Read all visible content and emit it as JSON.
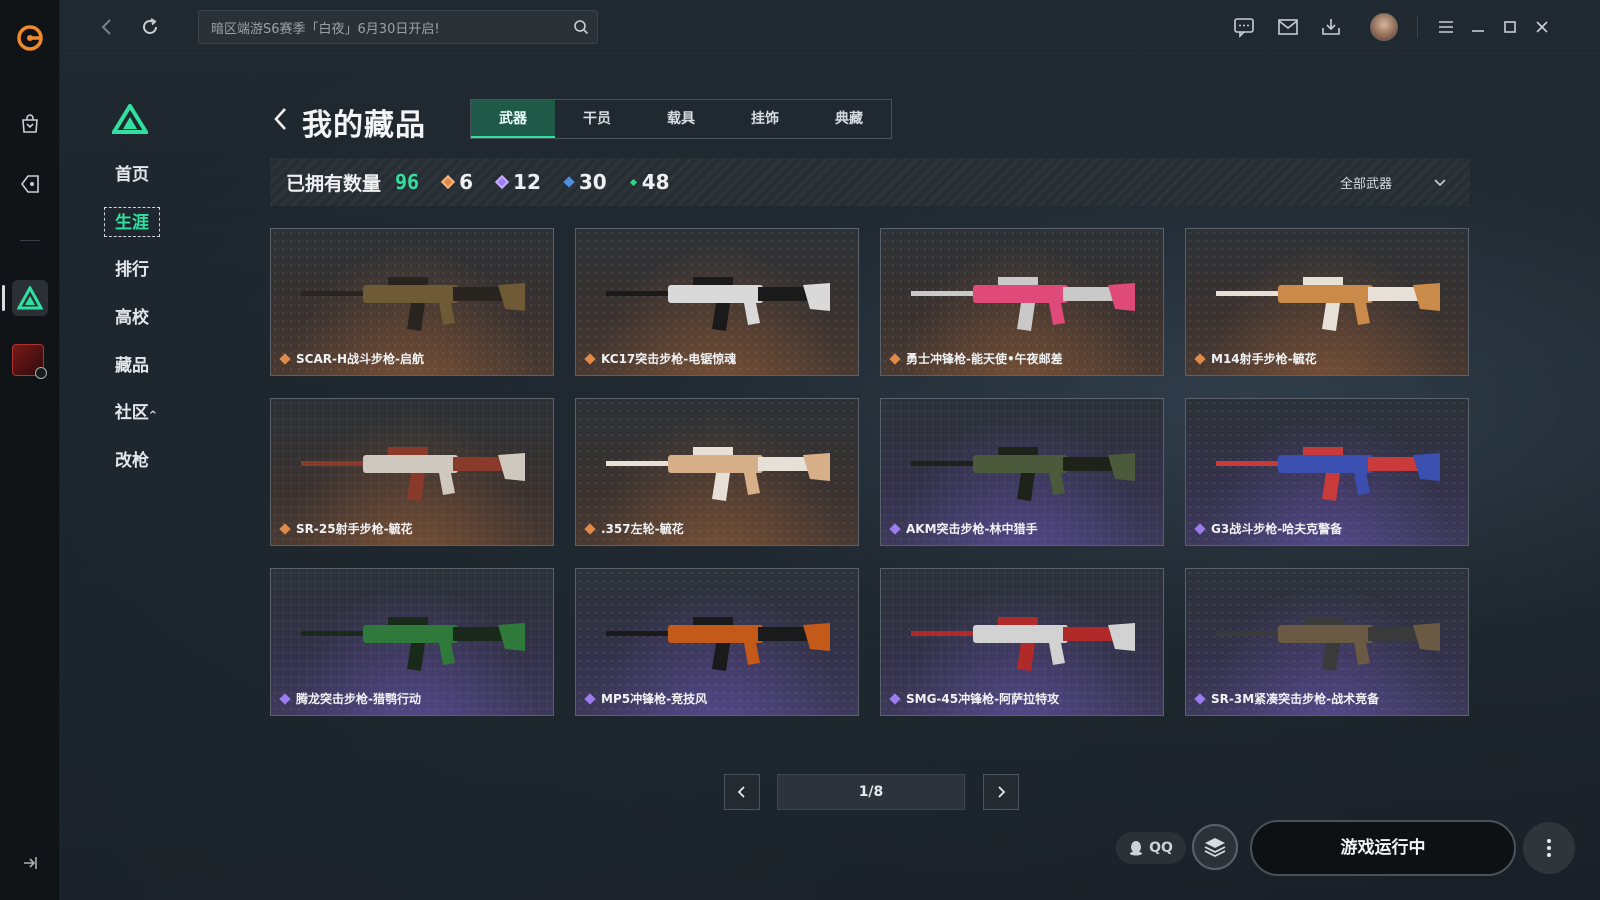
{
  "colors": {
    "accent": "#31e0a0",
    "gold_rarity": "#e08a4a",
    "purple_rarity": "#9d7cf0",
    "blue_rarity": "#4c8fe0",
    "green_rarity": "#2fd38a"
  },
  "search": {
    "text": "暗区端游S6赛季「白夜」6月30日开启!"
  },
  "sidebar": {
    "items": [
      {
        "label": "首页"
      },
      {
        "label": "生涯"
      },
      {
        "label": "排行"
      },
      {
        "label": "高校"
      },
      {
        "label": "藏品"
      },
      {
        "label": "社区",
        "caret": "^"
      },
      {
        "label": "改枪"
      }
    ]
  },
  "page": {
    "title": "我的藏品",
    "tabs": [
      {
        "label": "武器"
      },
      {
        "label": "干员"
      },
      {
        "label": "载具"
      },
      {
        "label": "挂饰"
      },
      {
        "label": "典藏"
      }
    ]
  },
  "stats": {
    "label": "已拥有数量",
    "total": "96",
    "counts": [
      {
        "value": "6",
        "tier": "gold"
      },
      {
        "value": "12",
        "tier": "purple"
      },
      {
        "value": "30",
        "tier": "blue"
      },
      {
        "value": "48",
        "tier": "green"
      }
    ],
    "filter": "全部武器"
  },
  "items": [
    {
      "name": "SCAR-H战斗步枪-启航",
      "tier": "gold"
    },
    {
      "name": "KC17突击步枪-电锯惊魂",
      "tier": "gold"
    },
    {
      "name": "勇士冲锋枪-能天使•午夜邮差",
      "tier": "gold"
    },
    {
      "name": "M14射手步枪-毓花",
      "tier": "gold"
    },
    {
      "name": "SR-25射手步枪-毓花",
      "tier": "gold"
    },
    {
      "name": ".357左轮-毓花",
      "tier": "gold"
    },
    {
      "name": "AKM突击步枪-林中猎手",
      "tier": "purple"
    },
    {
      "name": "G3战斗步枪-哈夫克警备",
      "tier": "purple"
    },
    {
      "name": "腾龙突击步枪-猎鹗行动",
      "tier": "purple"
    },
    {
      "name": "MP5冲锋枪-竞技风",
      "tier": "purple"
    },
    {
      "name": "SMG-45冲锋枪-阿萨拉特攻",
      "tier": "purple"
    },
    {
      "name": "SR-3M紧凑突击步枪-战术竞备",
      "tier": "purple"
    }
  ],
  "pager": {
    "current": "1/8"
  },
  "bottom": {
    "qq_label": "QQ",
    "launch_label": "游戏运行中"
  }
}
